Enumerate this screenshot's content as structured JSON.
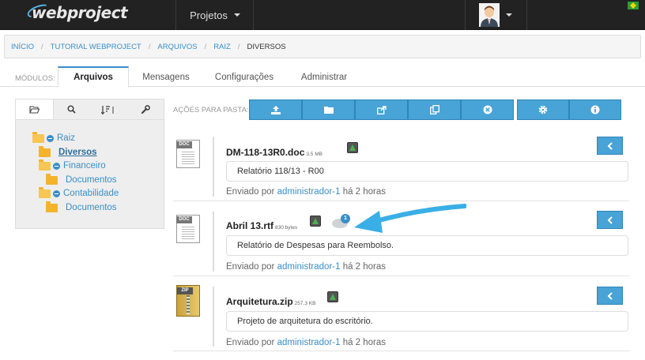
{
  "app": {
    "logo_text": "webproject"
  },
  "topbar": {
    "projects_label": "Projetos"
  },
  "breadcrumb": [
    {
      "label": "INÍCIO"
    },
    {
      "label": "TUTORIAL WEBPROJECT"
    },
    {
      "label": "ARQUIVOS"
    },
    {
      "label": "RAIZ"
    },
    {
      "label": "DIVERSOS"
    }
  ],
  "modules": {
    "label": "MÓDULOS:",
    "tabs": [
      {
        "label": "Arquivos",
        "active": true
      },
      {
        "label": "Mensagens"
      },
      {
        "label": "Configurações"
      },
      {
        "label": "Administrar"
      }
    ]
  },
  "left_panel": {
    "tabs": [
      "folder-open-icon",
      "search-icon",
      "sort-icon",
      "wrench-icon"
    ],
    "tree": [
      {
        "label": "Raiz"
      },
      {
        "label": "Diversos"
      },
      {
        "label": "Financeiro"
      },
      {
        "label": "Documentos"
      },
      {
        "label": "Contabilidade"
      },
      {
        "label": "Documentos"
      }
    ]
  },
  "actions": {
    "label": "AÇÕES PARA PASTA:",
    "buttons": [
      "upload-icon",
      "folder-icon",
      "share-icon",
      "copy-icon",
      "close-circle-icon",
      "gear-icon",
      "info-icon"
    ]
  },
  "files": [
    {
      "name": "DM-118-13R0.doc",
      "size": "3,5 MB",
      "description": "Relatório 118/13 - R00",
      "sent_prefix": "Enviado por",
      "user": "administrador-1",
      "time": "há 2 horas",
      "type_tag": "DOC"
    },
    {
      "name": "Abril 13.rtf",
      "size": "830 bytes",
      "description": "Relatório de Despesas para Reembolso.",
      "sent_prefix": "Enviado por",
      "user": "administrador-1",
      "time": "há 2 horas",
      "type_tag": "DOC",
      "comments": "1"
    },
    {
      "name": "Arquitetura.zip",
      "size": "257,3 KB",
      "description": "Projeto de arquitetura do escritório.",
      "sent_prefix": "Enviado por",
      "user": "administrador-1",
      "time": "há 2 horas",
      "type_tag": "ZIP"
    }
  ],
  "colors": {
    "accent": "#48a3d6",
    "link": "#3a8fc8",
    "topbar": "#222222",
    "badge_green": "#4caf50"
  }
}
